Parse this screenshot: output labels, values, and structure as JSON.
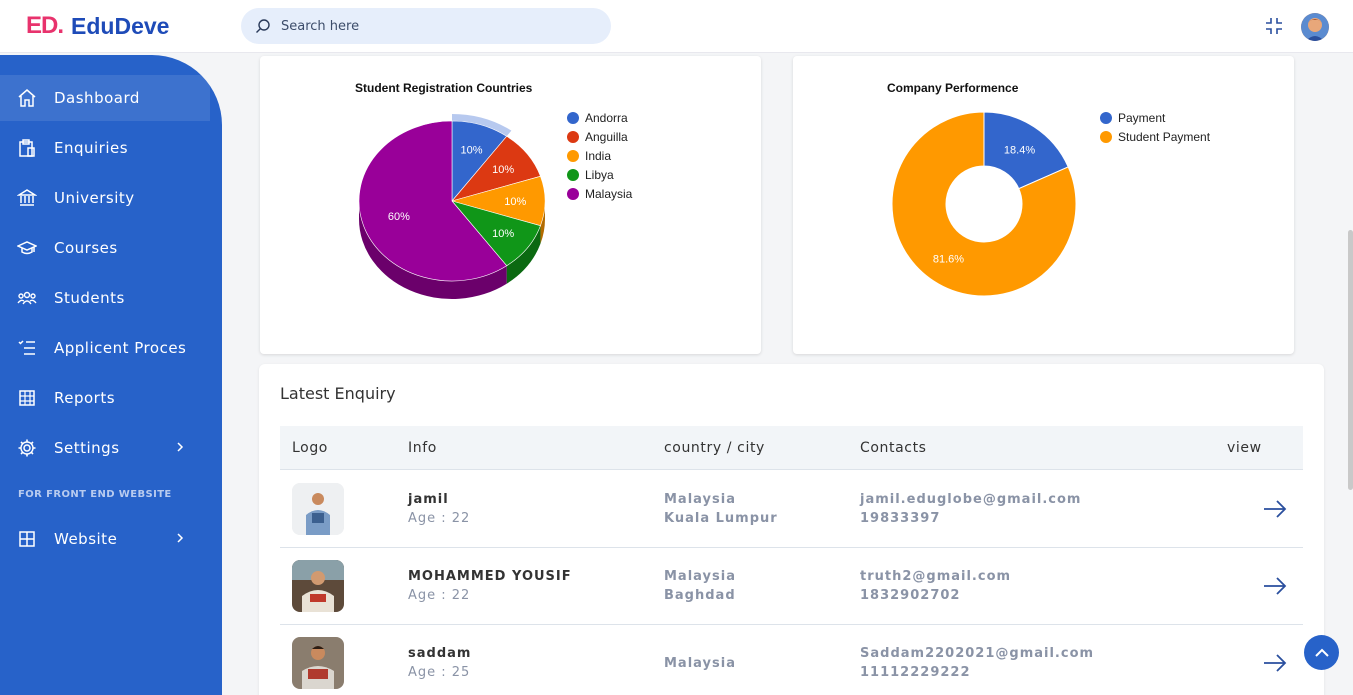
{
  "header": {
    "logo_mark": "ED.",
    "logo_text": "EduDeve",
    "search_placeholder": "Search here"
  },
  "sidebar": {
    "items": [
      {
        "label": "Dashboard"
      },
      {
        "label": "Enquiries"
      },
      {
        "label": "University"
      },
      {
        "label": "Courses"
      },
      {
        "label": "Students"
      },
      {
        "label": "Applicent Proces"
      },
      {
        "label": "Reports"
      },
      {
        "label": "Settings"
      }
    ],
    "section_label": "FOR FRONT END WEBSITE",
    "website_label": "Website"
  },
  "chart_data": [
    {
      "type": "pie",
      "title": "Student Registration Countries",
      "categories": [
        "Andorra",
        "Anguilla",
        "India",
        "Libya",
        "Malaysia"
      ],
      "values": [
        10,
        10,
        10,
        10,
        60
      ],
      "labels": [
        "10%",
        "10%",
        "10%",
        "10%",
        "60%"
      ],
      "colors": [
        "#3366cc",
        "#dc3912",
        "#ff9900",
        "#109618",
        "#990099"
      ],
      "legend": "right"
    },
    {
      "type": "pie",
      "title": "Company Performence",
      "categories": [
        "Payment",
        "Student Payment"
      ],
      "values": [
        18.4,
        81.6
      ],
      "labels": [
        "18.4%",
        "81.6%"
      ],
      "colors": [
        "#3366cc",
        "#ff9900"
      ],
      "donut": true,
      "legend": "right"
    }
  ],
  "enquiry": {
    "title": "Latest Enquiry",
    "columns": [
      "Logo",
      "Info",
      "country / city",
      "Contacts",
      "view"
    ],
    "rows": [
      {
        "name": "jamil",
        "age": "Age : 22",
        "country": "Malaysia",
        "city": "Kuala Lumpur",
        "email": "jamil.eduglobe@gmail.com",
        "phone": "19833397"
      },
      {
        "name": "MOHAMMED YOUSIF",
        "age": "Age : 22",
        "country": "Malaysia",
        "city": "Baghdad",
        "email": "truth2@gmail.com",
        "phone": "1832902702"
      },
      {
        "name": "saddam",
        "age": "Age : 25",
        "country": "Malaysia",
        "city": "",
        "email": "Saddam2202021@gmail.com",
        "phone": "11112229222"
      }
    ]
  }
}
